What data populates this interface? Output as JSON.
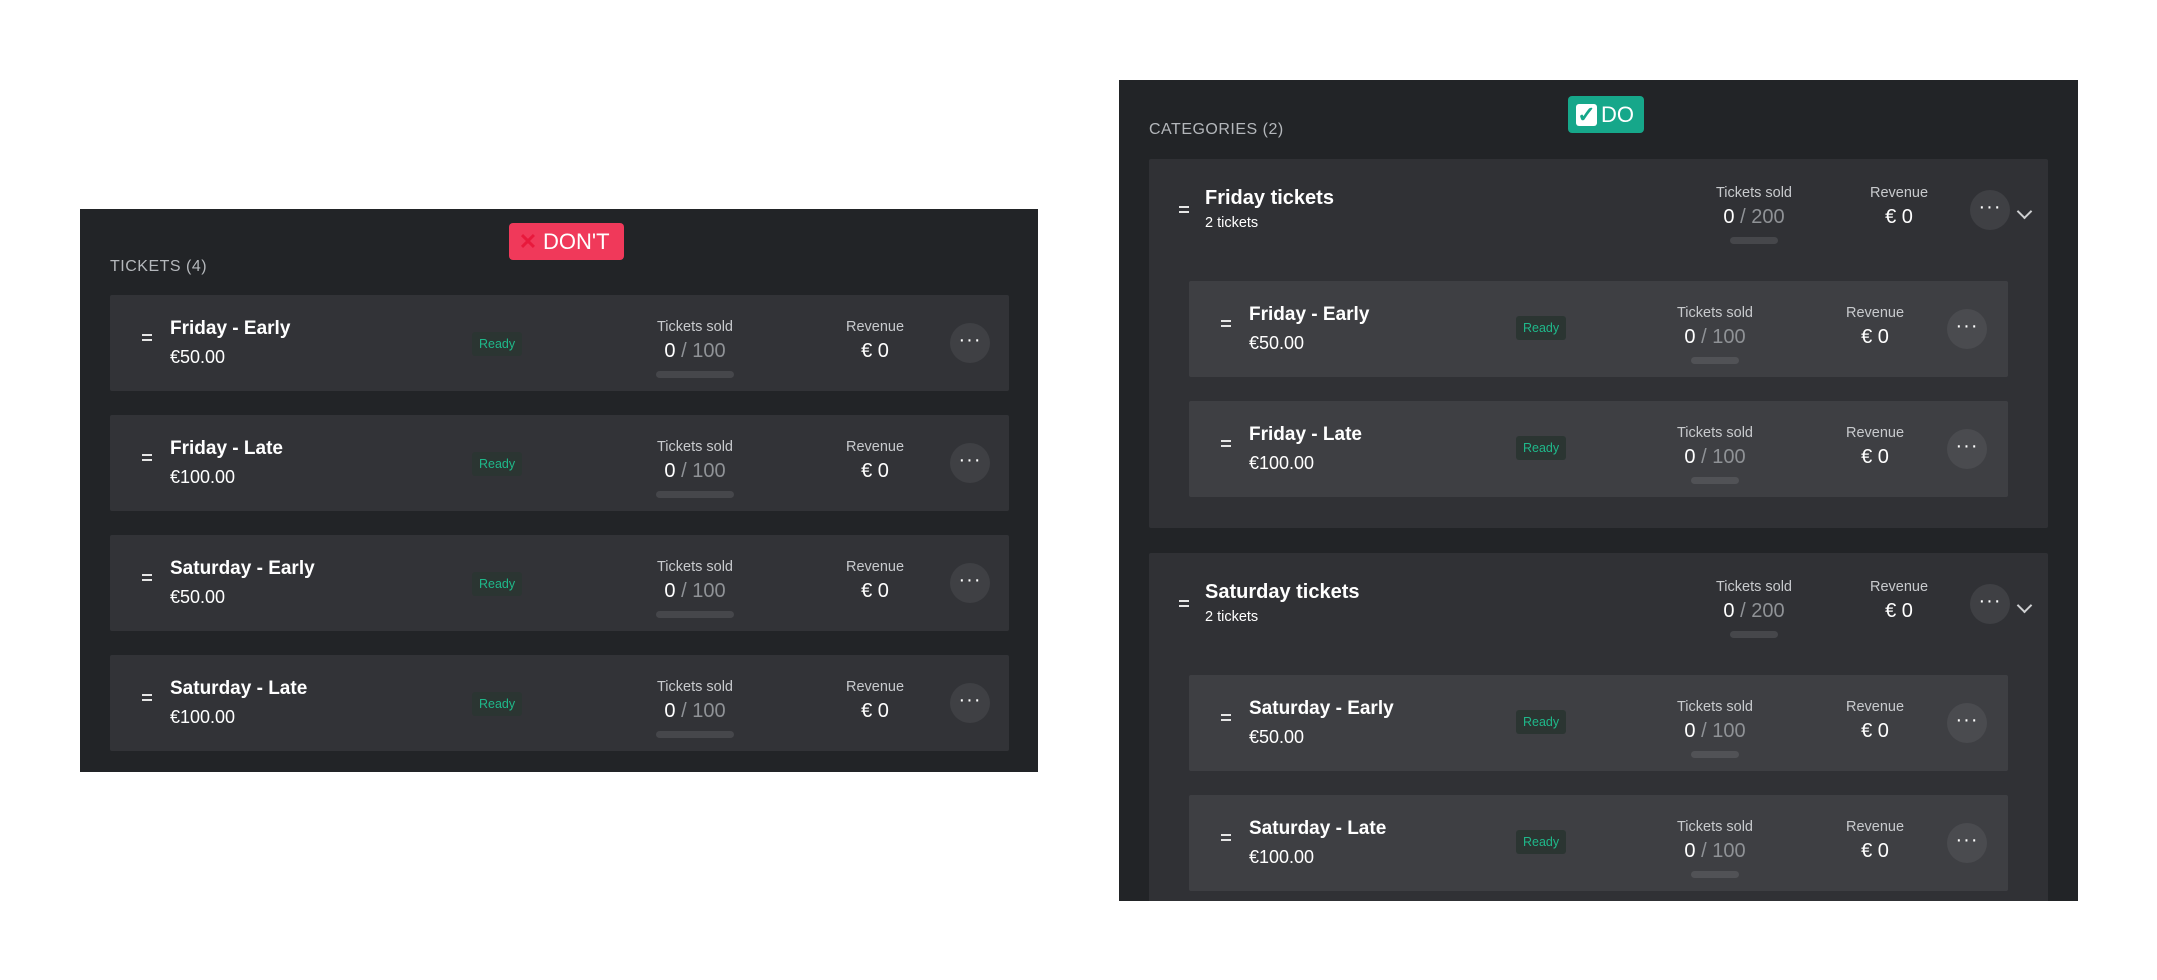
{
  "dont": {
    "badge": "DON'T",
    "section_title": "TICKETS (4)",
    "tickets": [
      {
        "name": "Friday - Early",
        "price": "€50.00",
        "status": "Ready",
        "sold_label": "Tickets sold",
        "sold": "0",
        "slash": "/",
        "total": "100",
        "revenue_label": "Revenue",
        "revenue": "€ 0",
        "more": "···"
      },
      {
        "name": "Friday - Late",
        "price": "€100.00",
        "status": "Ready",
        "sold_label": "Tickets sold",
        "sold": "0",
        "slash": "/",
        "total": "100",
        "revenue_label": "Revenue",
        "revenue": "€ 0",
        "more": "···"
      },
      {
        "name": "Saturday - Early",
        "price": "€50.00",
        "status": "Ready",
        "sold_label": "Tickets sold",
        "sold": "0",
        "slash": "/",
        "total": "100",
        "revenue_label": "Revenue",
        "revenue": "€ 0",
        "more": "···"
      },
      {
        "name": "Saturday - Late",
        "price": "€100.00",
        "status": "Ready",
        "sold_label": "Tickets sold",
        "sold": "0",
        "slash": "/",
        "total": "100",
        "revenue_label": "Revenue",
        "revenue": "€ 0",
        "more": "···"
      }
    ]
  },
  "do": {
    "badge": "DO",
    "section_title": "CATEGORIES (2)",
    "categories": [
      {
        "name": "Friday tickets",
        "count": "2 tickets",
        "sold_label": "Tickets sold",
        "sold": "0",
        "slash": "/",
        "total": "200",
        "revenue_label": "Revenue",
        "revenue": "€ 0",
        "more": "···",
        "tickets": [
          {
            "name": "Friday - Early",
            "price": "€50.00",
            "status": "Ready",
            "sold_label": "Tickets sold",
            "sold": "0",
            "slash": "/",
            "total": "100",
            "revenue_label": "Revenue",
            "revenue": "€ 0",
            "more": "···"
          },
          {
            "name": "Friday - Late",
            "price": "€100.00",
            "status": "Ready",
            "sold_label": "Tickets sold",
            "sold": "0",
            "slash": "/",
            "total": "100",
            "revenue_label": "Revenue",
            "revenue": "€ 0",
            "more": "···"
          }
        ]
      },
      {
        "name": "Saturday tickets",
        "count": "2 tickets",
        "sold_label": "Tickets sold",
        "sold": "0",
        "slash": "/",
        "total": "200",
        "revenue_label": "Revenue",
        "revenue": "€ 0",
        "more": "···",
        "tickets": [
          {
            "name": "Saturday - Early",
            "price": "€50.00",
            "status": "Ready",
            "sold_label": "Tickets sold",
            "sold": "0",
            "slash": "/",
            "total": "100",
            "revenue_label": "Revenue",
            "revenue": "€ 0",
            "more": "···"
          },
          {
            "name": "Saturday - Late",
            "price": "€100.00",
            "status": "Ready",
            "sold_label": "Tickets sold",
            "sold": "0",
            "slash": "/",
            "total": "100",
            "revenue_label": "Revenue",
            "revenue": "€ 0",
            "more": "···"
          }
        ]
      }
    ]
  }
}
